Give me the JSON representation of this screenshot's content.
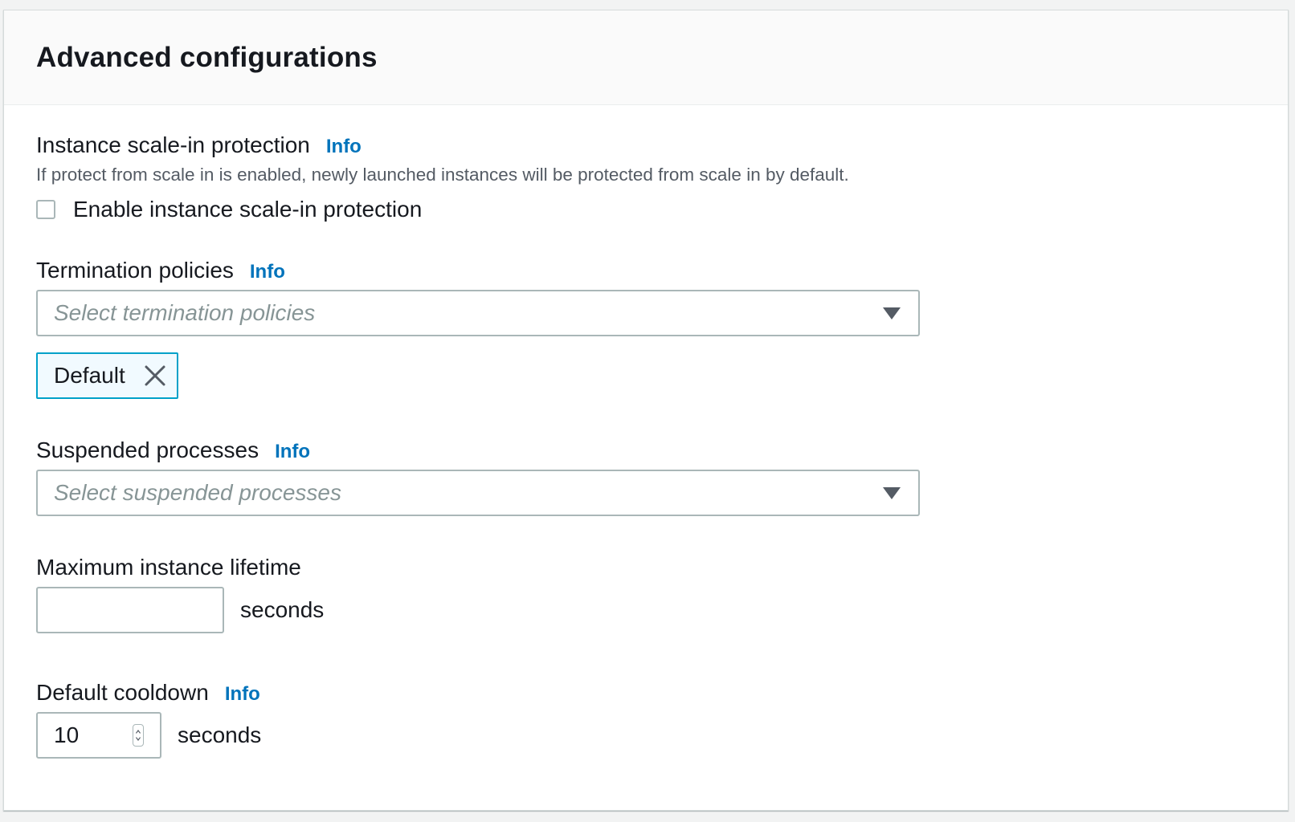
{
  "section": {
    "title": "Advanced configurations"
  },
  "scale_in_protection": {
    "label": "Instance scale-in protection",
    "info": "Info",
    "description": "If protect from scale in is enabled, newly launched instances will be protected from scale in by default.",
    "checkbox_label": "Enable instance scale-in protection",
    "checked": false
  },
  "termination_policies": {
    "label": "Termination policies",
    "info": "Info",
    "placeholder": "Select termination policies",
    "tokens": [
      {
        "label": "Default"
      }
    ]
  },
  "suspended_processes": {
    "label": "Suspended processes",
    "info": "Info",
    "placeholder": "Select suspended processes"
  },
  "max_instance_lifetime": {
    "label": "Maximum instance lifetime",
    "value": "",
    "unit": "seconds"
  },
  "default_cooldown": {
    "label": "Default cooldown",
    "info": "Info",
    "value": "10",
    "unit": "seconds"
  },
  "colors": {
    "link": "#0073bb",
    "token_border": "#00a1c9",
    "token_bg": "#f1faff",
    "input_border": "#aab7b8",
    "text": "#16191f",
    "muted": "#545b64",
    "placeholder": "#879596"
  },
  "icons": {
    "dropdown": "caret-down-icon",
    "dismiss": "close-icon",
    "spinner": "spinner-arrows-icon"
  }
}
